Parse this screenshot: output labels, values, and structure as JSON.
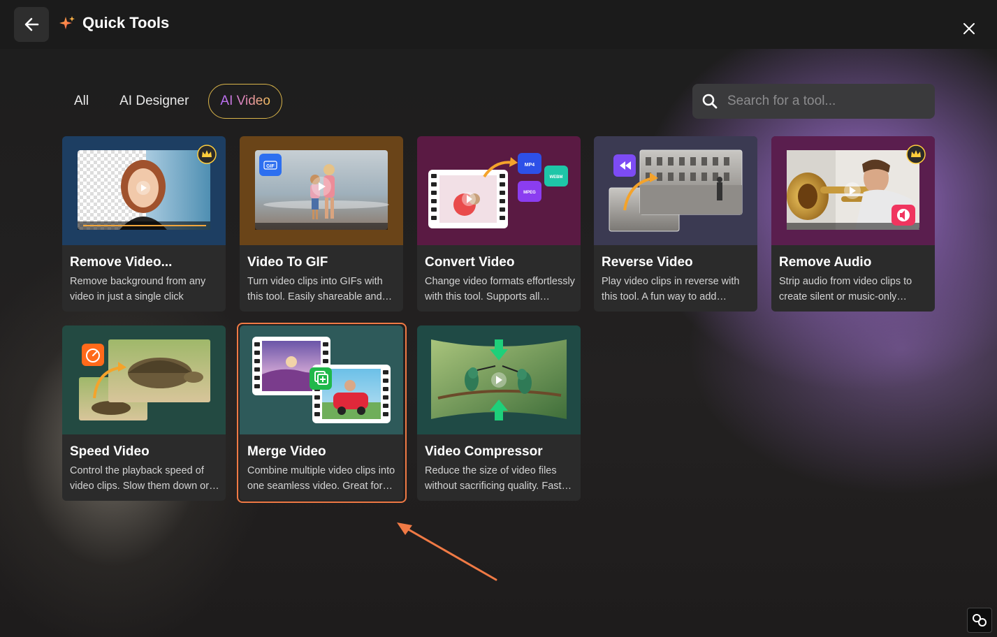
{
  "header": {
    "title": "Quick Tools"
  },
  "tabs": [
    {
      "label": "All"
    },
    {
      "label": "AI Designer"
    },
    {
      "label": "AI Video"
    }
  ],
  "search": {
    "placeholder": "Search for a tool..."
  },
  "cards": [
    {
      "name": "Remove Video...",
      "desc": "Remove background from any video in just a single click",
      "premium": true
    },
    {
      "name": "Video To GIF",
      "desc": "Turn video clips into GIFs with this tool. Easily shareable and perfect for social media.",
      "badge": "GIF"
    },
    {
      "name": "Convert Video",
      "desc": "Change video formats effortlessly with this tool. Supports all popular formats.",
      "formats": [
        "MP4",
        "WEBM",
        "MPEG"
      ]
    },
    {
      "name": "Reverse Video",
      "desc": "Play video clips in reverse with this tool. A fun way to add creative effects.",
      "premium": false
    },
    {
      "name": "Remove Audio",
      "desc": "Strip audio from video clips to create silent or music-only videos.",
      "premium": true
    },
    {
      "name": "Speed Video",
      "desc": "Control the playback speed of video clips. Slow them down or speed them up.",
      "premium": false
    },
    {
      "name": "Merge Video",
      "desc": "Combine multiple video clips into one seamless video. Great for stories.",
      "premium": false
    },
    {
      "name": "Video Compressor",
      "desc": "Reduce the size of video files without sacrificing quality. Fast and easy.",
      "premium": false
    }
  ],
  "colors": {
    "accent": "#f07a45",
    "active_tab_border": "#d9b44a",
    "card_bg": "#2b2b2b"
  }
}
